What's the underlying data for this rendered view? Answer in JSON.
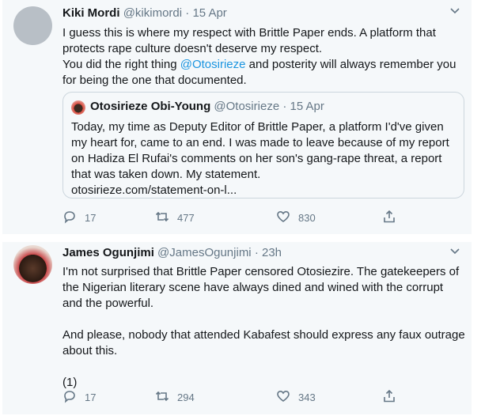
{
  "tweets": [
    {
      "name": "Kiki Mordi",
      "handle": "@kikimordi",
      "dot": "·",
      "time": "15 Apr",
      "menu_icon": "chevron-down-icon",
      "lines": [
        "I guess this is where my respect with Brittle Paper ends. A platform that",
        "protects rape culture doesn't deserve my respect."
      ],
      "line3_pre": "You did the right thing ",
      "line3_mention": "@Otosirieze",
      "line3_post": " and posterity will always remember you",
      "line4": "for being the one that documented.",
      "quote": {
        "name": "Otosirieze Obi-Young",
        "handle": "@Otosirieze",
        "dot": "·",
        "time": "15 Apr",
        "lines": [
          "Today, my time as Deputy Editor of Brittle Paper, a platform I'd've given",
          "my heart for, came to an end. I was made to leave because of my report",
          "on Hadiza El Rufai's comments on her son's gang-rape threat, a report",
          "that was taken down. My statement.",
          "otosirieze.com/statement-on-l..."
        ]
      },
      "replies": "17",
      "retweets": "477",
      "likes": "830"
    },
    {
      "name": "James Ogunjimi",
      "handle": "@JamesOgunjimi",
      "dot": "·",
      "time": "23h",
      "menu_icon": "chevron-down-icon",
      "lines": [
        "I'm not surprised that Brittle Paper censored Otosiezire. The gatekeepers of",
        "the Nigerian literary scene have always dined and wined with the corrupt",
        "and the powerful.",
        "",
        "And please, nobody that attended Kabafest should express any faux outrage",
        "about this.",
        "",
        "(1)"
      ],
      "replies": "17",
      "retweets": "294",
      "likes": "343"
    }
  ]
}
